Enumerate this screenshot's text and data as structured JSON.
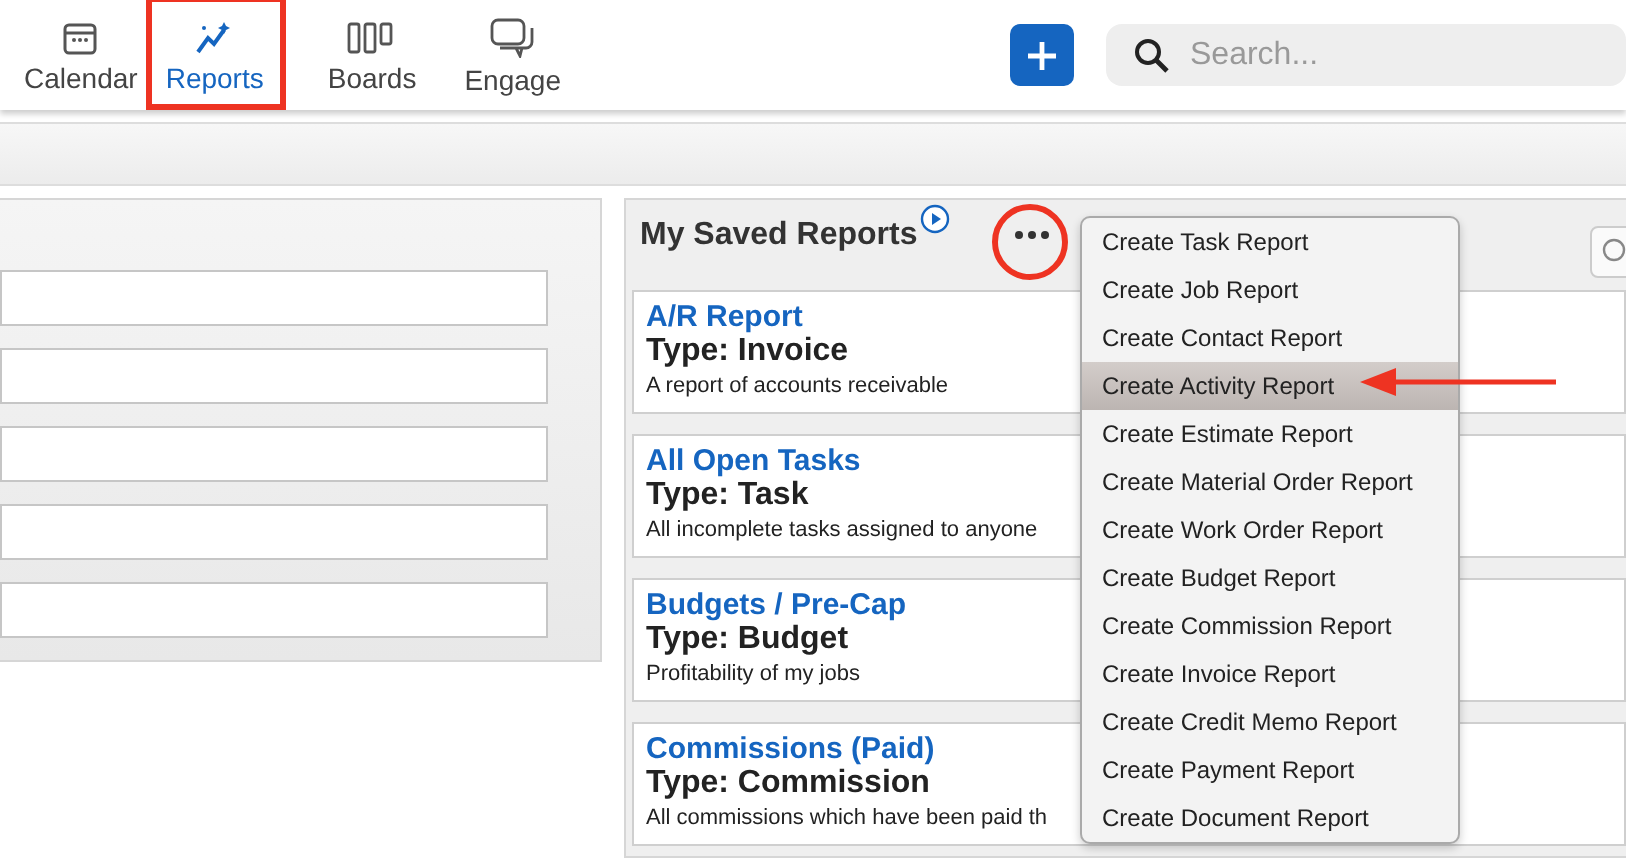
{
  "nav": {
    "items": [
      {
        "label": "Calendar",
        "selected": false
      },
      {
        "label": "Reports",
        "selected": true
      },
      {
        "label": "Boards",
        "selected": false
      },
      {
        "label": "Engage",
        "selected": false
      }
    ]
  },
  "search": {
    "placeholder": "Search..."
  },
  "saved_reports": {
    "title": "My Saved Reports",
    "reports": [
      {
        "name": "A/R Report",
        "type": "Type: Invoice",
        "description": "A report of accounts receivable"
      },
      {
        "name": "All Open Tasks",
        "type": "Type: Task",
        "description": "All incomplete tasks assigned to anyone"
      },
      {
        "name": "Budgets / Pre-Cap",
        "type": "Type: Budget",
        "description": "Profitability of my jobs"
      },
      {
        "name": "Commissions (Paid)",
        "type": "Type: Commission",
        "description": "All commissions which have been paid th"
      }
    ]
  },
  "menu": {
    "items": [
      {
        "label": "Create Task Report",
        "selected": false
      },
      {
        "label": "Create Job Report",
        "selected": false
      },
      {
        "label": "Create Contact Report",
        "selected": false
      },
      {
        "label": "Create Activity Report",
        "selected": true
      },
      {
        "label": "Create Estimate Report",
        "selected": false
      },
      {
        "label": "Create Material Order Report",
        "selected": false
      },
      {
        "label": "Create Work Order Report",
        "selected": false
      },
      {
        "label": "Create Budget Report",
        "selected": false
      },
      {
        "label": "Create Commission Report",
        "selected": false
      },
      {
        "label": "Create Invoice Report",
        "selected": false
      },
      {
        "label": "Create Credit Memo Report",
        "selected": false
      },
      {
        "label": "Create Payment Report",
        "selected": false
      },
      {
        "label": "Create Document Report",
        "selected": false
      }
    ]
  }
}
